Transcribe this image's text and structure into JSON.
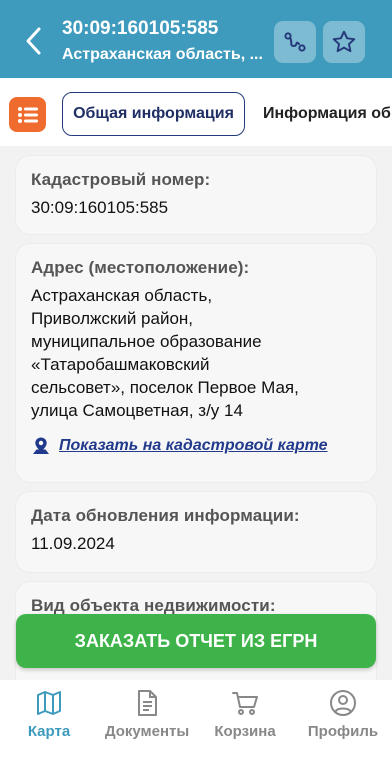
{
  "header": {
    "title": "30:09:160105:585",
    "subtitle": "Астраханская область, ..."
  },
  "tabs": [
    {
      "label": "Общая информация",
      "active": true
    },
    {
      "label": "Информация об",
      "active": false
    }
  ],
  "cards": {
    "cadastral": {
      "label": "Кадастровый номер:",
      "value": "30:09:160105:585"
    },
    "address": {
      "label": "Адрес (местоположение):",
      "lines": [
        "Астраханская область,",
        "Приволжский район,",
        "муниципальное образование",
        "«Татаробашмаковский",
        "сельсовет», поселок Первое Мая,",
        "улица Самоцветная, з/у 14"
      ],
      "map_link": "Показать на кадастровой карте"
    },
    "updated": {
      "label": "Дата обновления информации:",
      "value": "11.09.2024"
    },
    "object_type": {
      "label": "Вид объекта недвижимости:"
    }
  },
  "order_button": "ЗАКАЗАТЬ ОТЧЕТ ИЗ ЕГРН",
  "nav": [
    {
      "label": "Карта",
      "icon": "map-icon",
      "active": true
    },
    {
      "label": "Документы",
      "icon": "document-icon",
      "active": false
    },
    {
      "label": "Корзина",
      "icon": "cart-icon",
      "active": false
    },
    {
      "label": "Профиль",
      "icon": "profile-icon",
      "active": false
    }
  ],
  "colors": {
    "header": "#3f9bbd",
    "menu_button": "#ef6b2e",
    "order_button": "#3db34a",
    "active_tab_border": "#243a7a",
    "link": "#223a8c",
    "nav_active": "#3f9bbd"
  }
}
